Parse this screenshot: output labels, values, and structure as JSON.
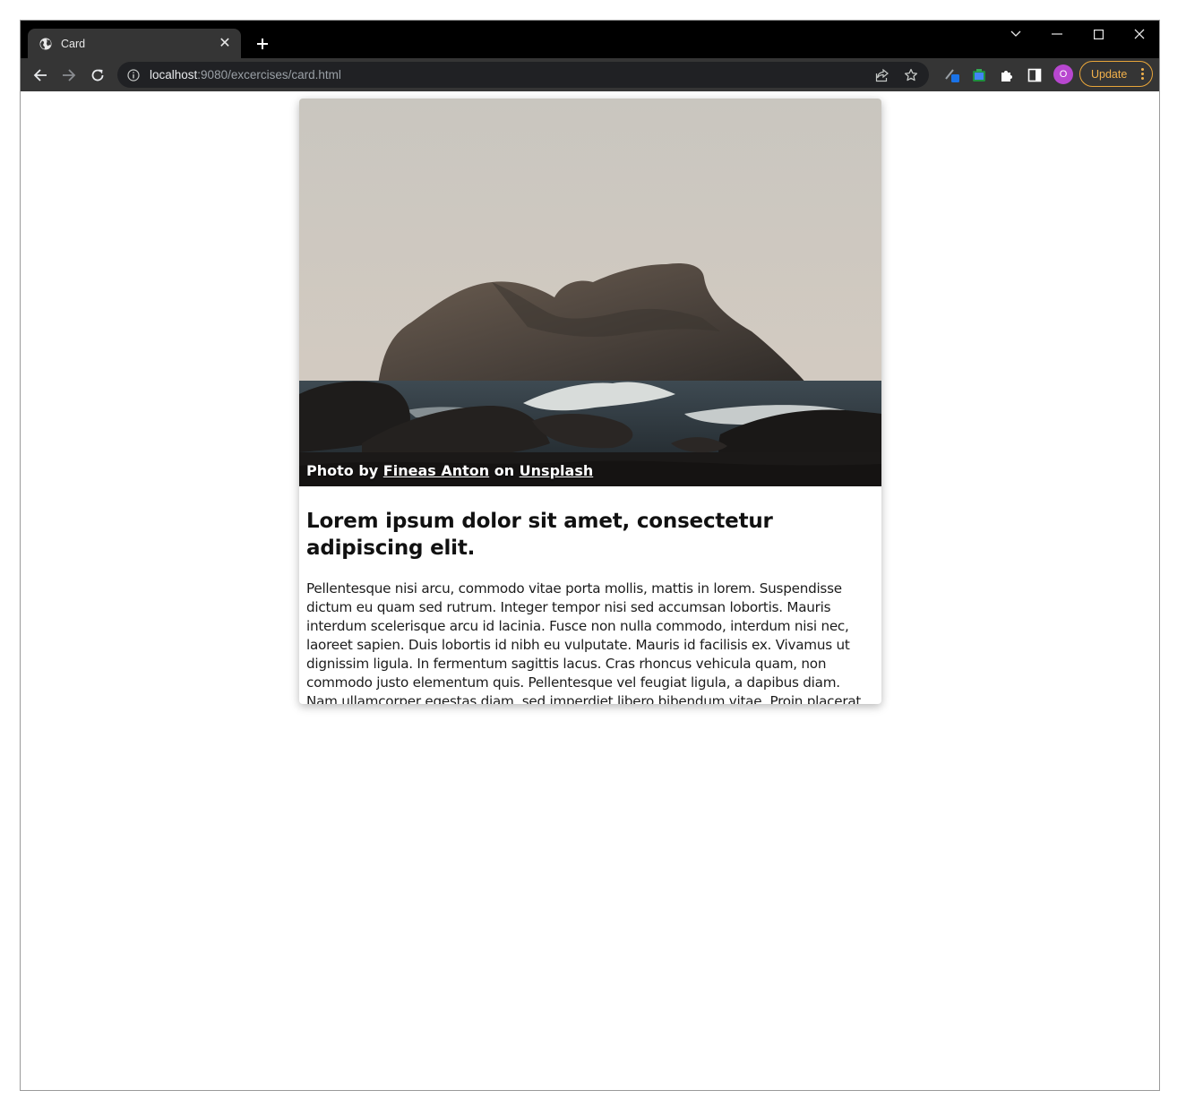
{
  "browser": {
    "tab": {
      "title": "Card",
      "favicon": "globe-icon",
      "close_label": "✕"
    },
    "new_tab_label": "+",
    "address_bar": {
      "host": "localhost",
      "path": ":9080/excercises/card.html"
    },
    "profile_initial": "O",
    "update_label": "Update"
  },
  "card": {
    "credit": {
      "prefix": "Photo by ",
      "author": "Fineas Anton",
      "middle": " on ",
      "site": "Unsplash"
    },
    "title": "Lorem ipsum dolor sit amet, consectetur adipiscing elit.",
    "body": "Pellentesque nisi arcu, commodo vitae porta mollis, mattis in lorem. Suspendisse dictum eu quam sed rutrum. Integer tempor nisi sed accumsan lobortis. Mauris interdum scelerisque arcu id lacinia. Fusce non nulla commodo, interdum nisi nec, laoreet sapien. Duis lobortis id nibh eu vulputate. Mauris id facilisis ex. Vivamus ut dignissim ligula. In fermentum sagittis lacus. Cras rhoncus vehicula quam, non commodo justo elementum quis. Pellentesque vel feugiat ligula, a dapibus diam. Nam ullamcorper egestas diam, sed imperdiet libero bibendum vitae. Proin placerat ac lectus sagittis congue."
  },
  "colors": {
    "tabstrip": "#000000",
    "toolbar": "#353535",
    "update_accent": "#f2b14b",
    "avatar": "#b847d0"
  }
}
